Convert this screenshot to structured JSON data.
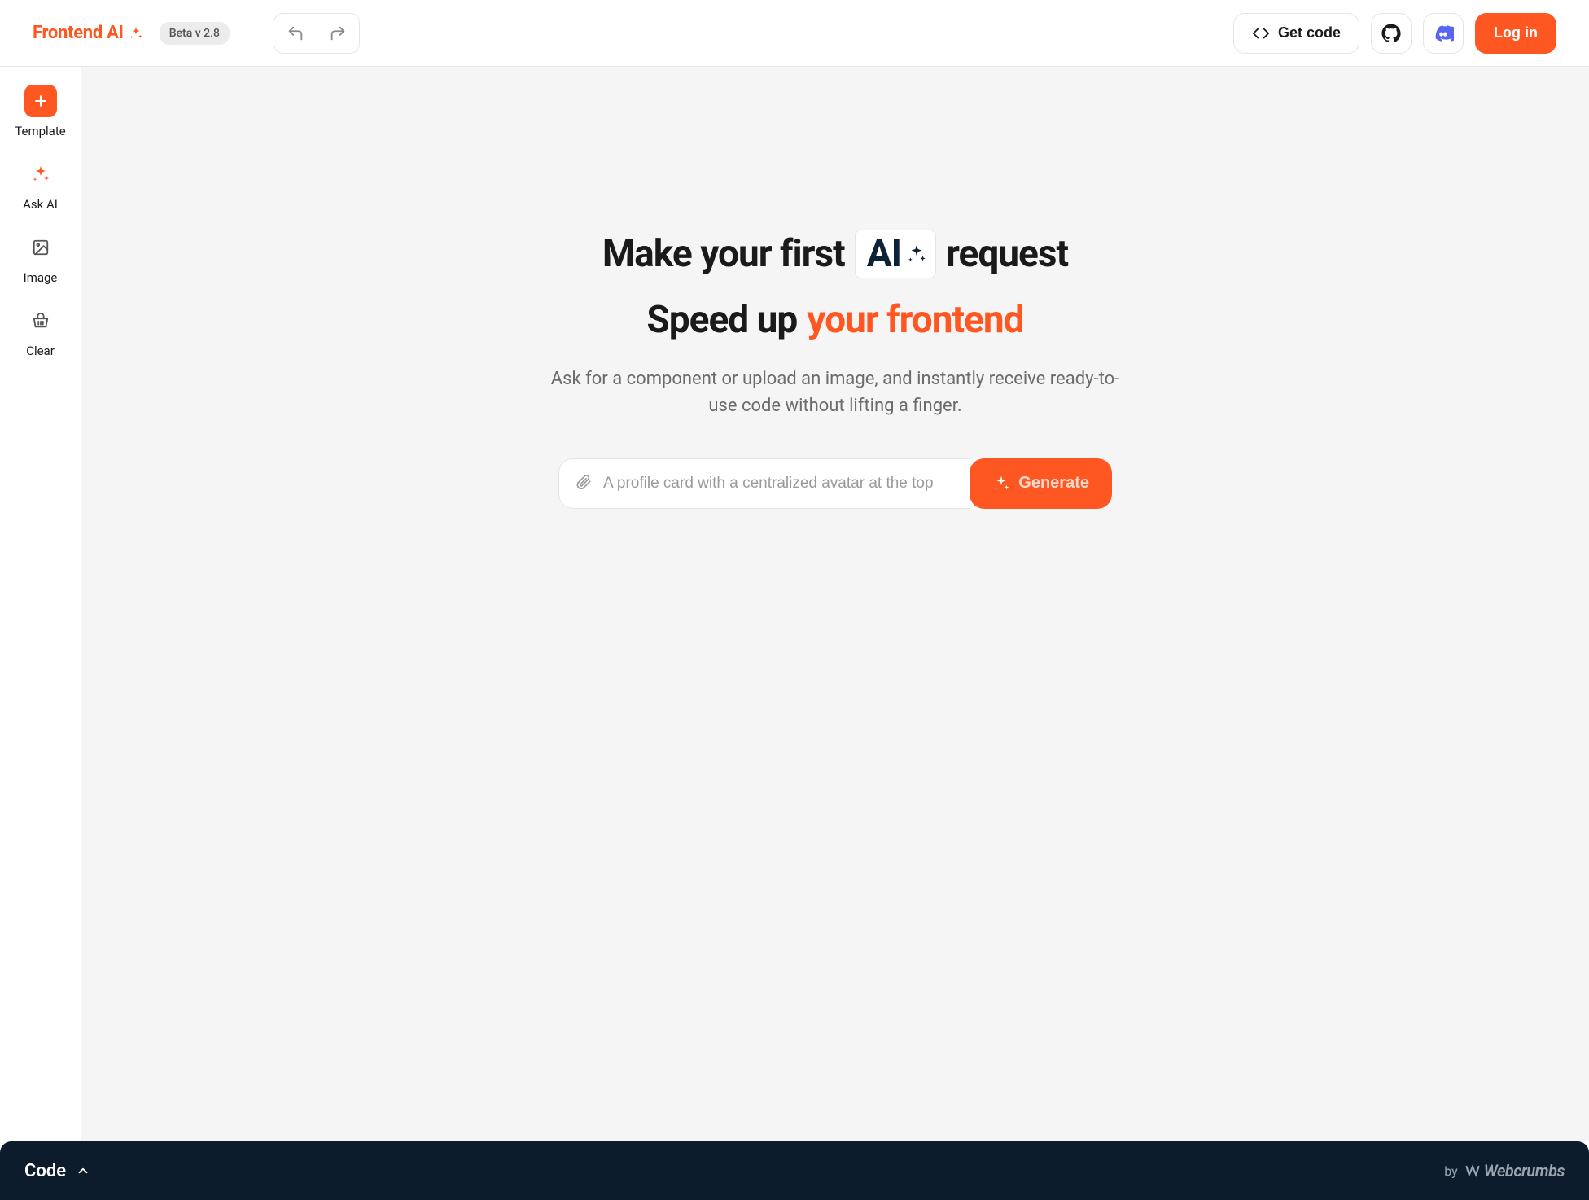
{
  "header": {
    "logo_text": "Frontend AI",
    "beta_label": "Beta v 2.8",
    "get_code_label": "Get code",
    "login_label": "Log in"
  },
  "sidebar": {
    "items": [
      {
        "label": "Template"
      },
      {
        "label": "Ask AI"
      },
      {
        "label": "Image"
      },
      {
        "label": "Clear"
      }
    ]
  },
  "hero": {
    "headline_pre": "Make your first",
    "headline_pill": "AI",
    "headline_post": "request",
    "headline_line2_pre": "Speed up",
    "headline_line2_accent": "your frontend",
    "subhead": "Ask for a component or upload an image, and instantly receive ready-to-use code without lifting a finger.",
    "placeholder": "A profile card with a centralized avatar at the top",
    "generate_label": "Generate"
  },
  "footer": {
    "code_label": "Code",
    "by_label": "by",
    "brand": "Webcrumbs"
  }
}
